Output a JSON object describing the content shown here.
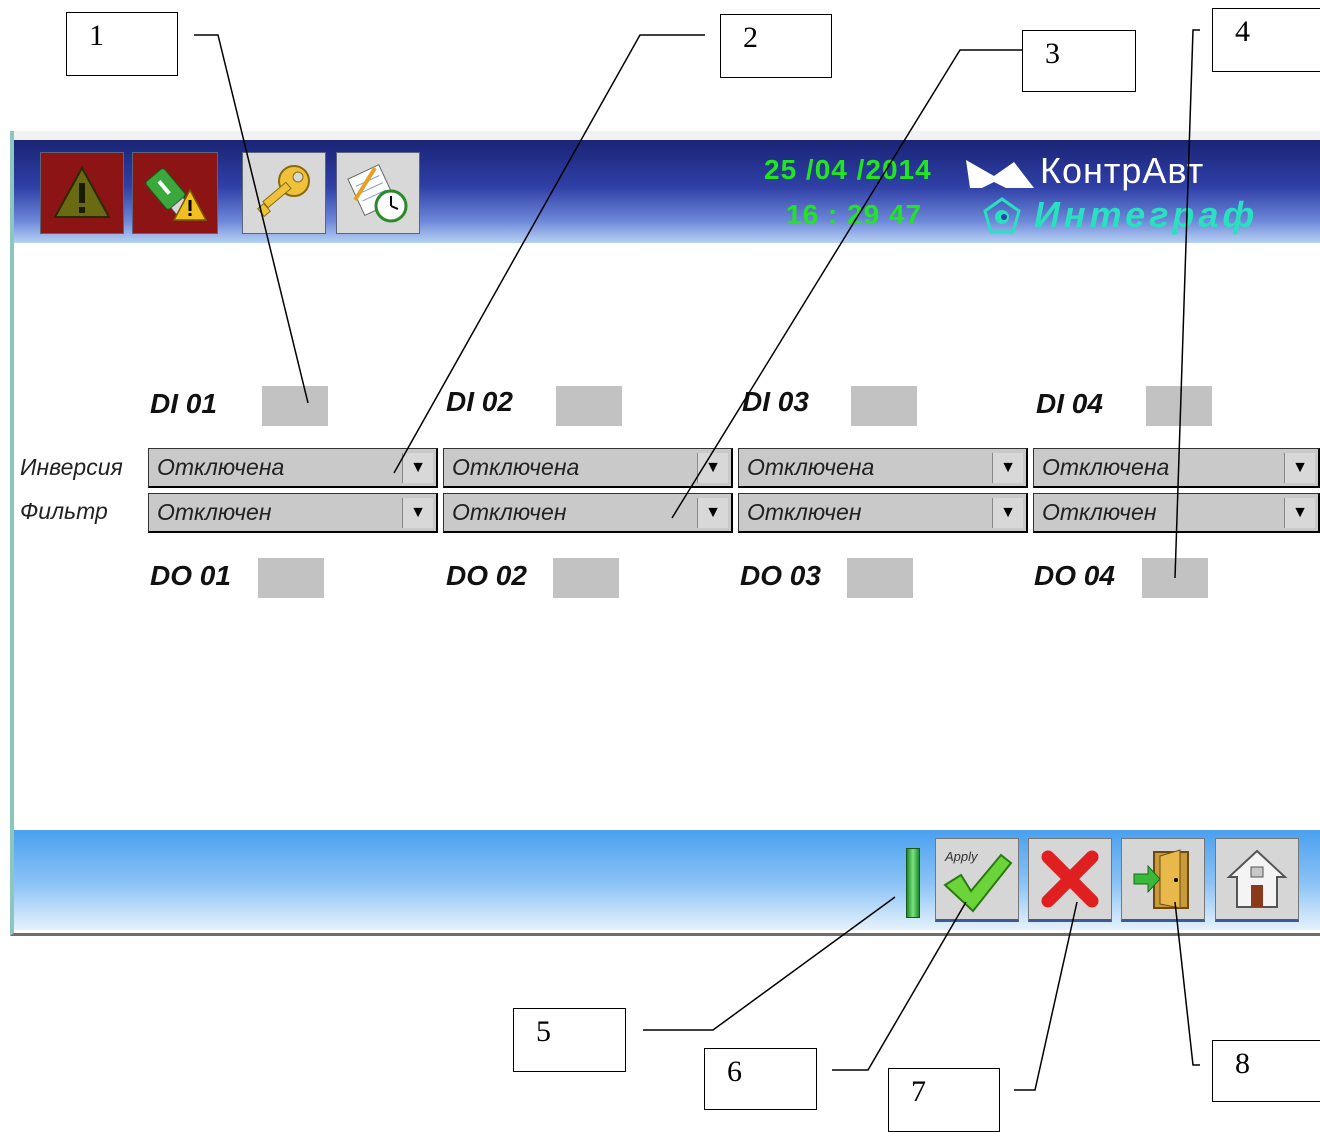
{
  "callouts": [
    "1",
    "2",
    "3",
    "4",
    "5",
    "6",
    "7",
    "8"
  ],
  "header": {
    "date": "25 /04 /2014",
    "time": "16 : 29  47",
    "brand_top": "КонтрАвт",
    "brand_bottom": "Интеграф"
  },
  "toolbar_icons": [
    "alarm-icon",
    "usb-warning-icon",
    "key-icon",
    "schedule-icon"
  ],
  "channels": [
    {
      "di": "DI 01",
      "do": "DO 01",
      "inversion": "Отключена",
      "filter": "Отключен"
    },
    {
      "di": "DI 02",
      "do": "DO 02",
      "inversion": "Отключена",
      "filter": "Отключен"
    },
    {
      "di": "DI 03",
      "do": "DO 03",
      "inversion": "Отключена",
      "filter": "Отключен"
    },
    {
      "di": "DI 04",
      "do": "DO 04",
      "inversion": "Отключена",
      "filter": "Отключен"
    }
  ],
  "rows": {
    "inversion_label": "Инверсия",
    "filter_label": "Фильтр"
  },
  "bottom": {
    "apply_label": "Apply"
  },
  "colors": {
    "header_dark": "#1a2476",
    "datetime": "#22e522",
    "brand_sub": "#29e0c0",
    "indicator": "#c2c2c2"
  }
}
